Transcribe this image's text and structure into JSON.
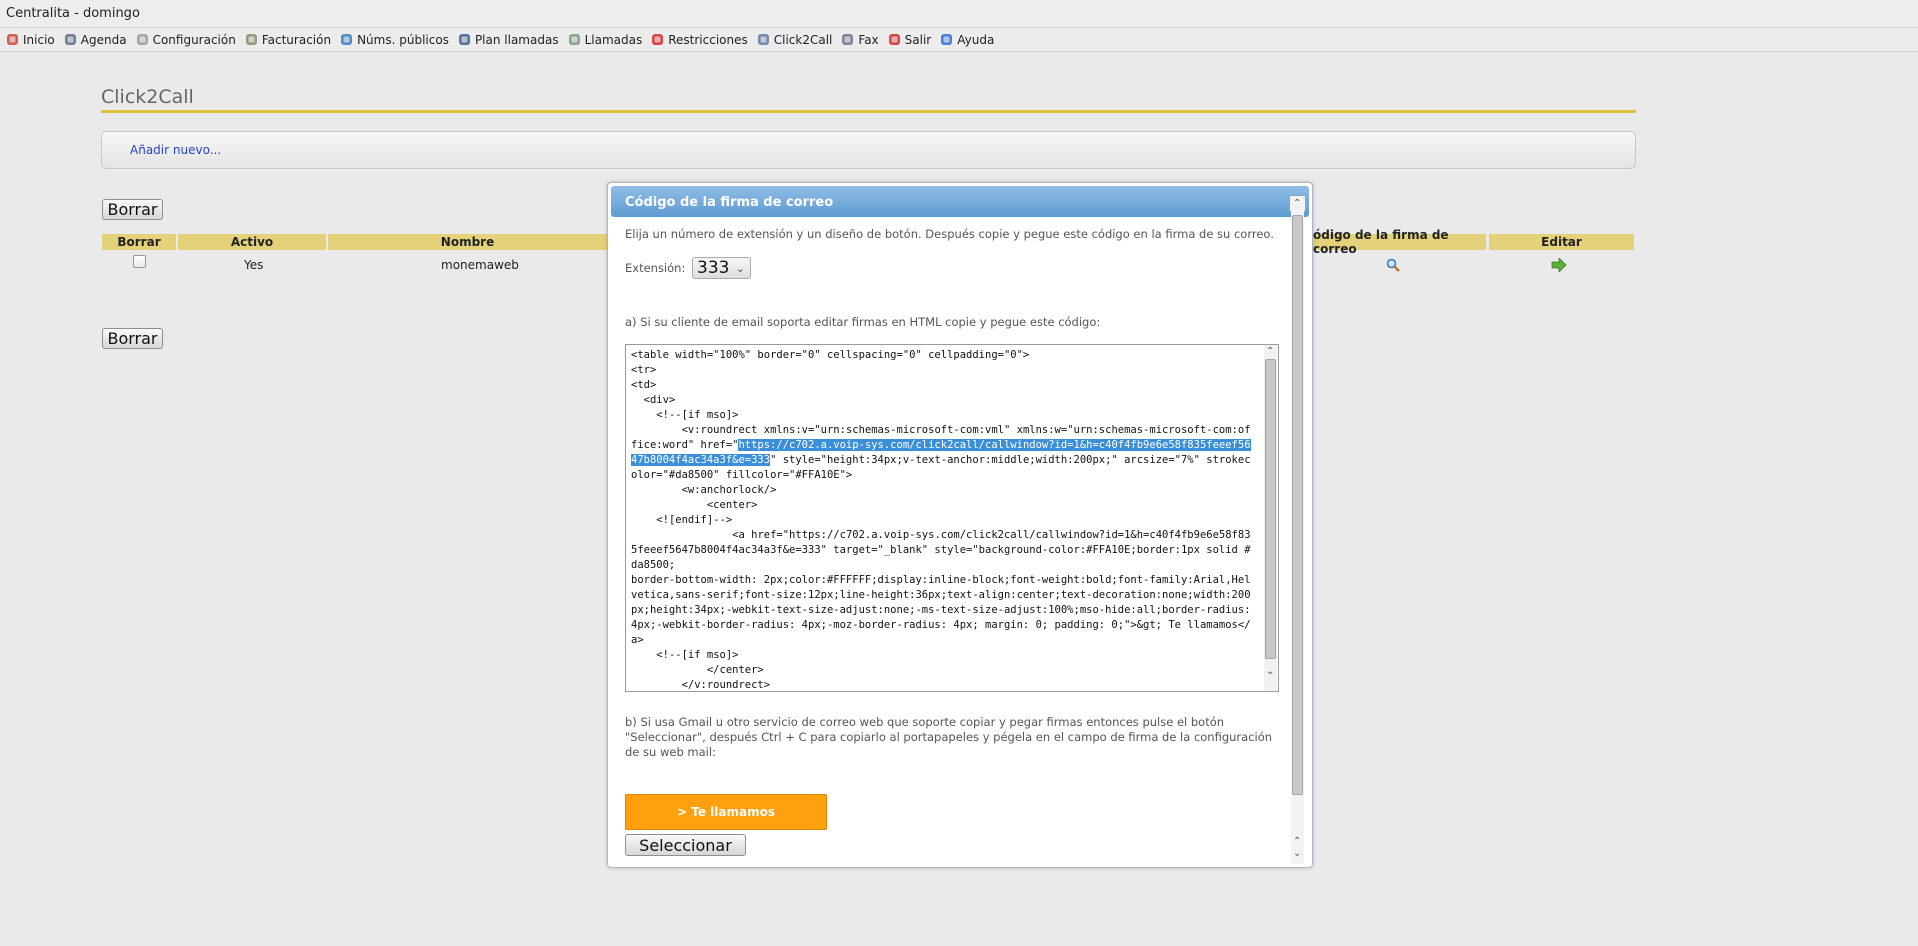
{
  "window": {
    "title": "Centralita - domingo"
  },
  "menu": [
    {
      "label": "Inicio",
      "icon": "home-icon",
      "color": "#c8493a"
    },
    {
      "label": "Agenda",
      "icon": "agenda-icon",
      "color": "#5a6f8a"
    },
    {
      "label": "Configuración",
      "icon": "gear-icon",
      "color": "#9a9a9a"
    },
    {
      "label": "Facturación",
      "icon": "billing-icon",
      "color": "#8a8a6a"
    },
    {
      "label": "Núms. públicos",
      "icon": "globe-icon",
      "color": "#3b7cc0"
    },
    {
      "label": "Plan llamadas",
      "icon": "plan-icon",
      "color": "#3f5f8f"
    },
    {
      "label": "Llamadas",
      "icon": "phone-icon",
      "color": "#7a9a7a"
    },
    {
      "label": "Restricciones",
      "icon": "stop-icon",
      "color": "#d22b2b"
    },
    {
      "label": "Click2Call",
      "icon": "window-icon",
      "color": "#5f7a9a"
    },
    {
      "label": "Fax",
      "icon": "fax-icon",
      "color": "#6f6f8f"
    },
    {
      "label": "Salir",
      "icon": "power-icon",
      "color": "#d22b2b"
    },
    {
      "label": "Ayuda",
      "icon": "help-icon",
      "color": "#2f6fd0"
    }
  ],
  "page": {
    "title": "Click2Call",
    "add_new": "Añadir nuevo...",
    "delete_button": "Borrar",
    "table": {
      "headers": [
        "Borrar",
        "Activo",
        "Nombre",
        "ódigo de la firma de correo",
        "Editar"
      ],
      "row": {
        "active": "Yes",
        "name": "monemaweb"
      }
    }
  },
  "dialog": {
    "title": "Código de la firma de correo",
    "intro": "Elija un número de extensión y un diseño de botón. Después copie y pegue este código en la firma de su correo.",
    "extension_label": "Extensión:",
    "extension_value": "333",
    "step_a": "a) Si su cliente de email soporta editar firmas en HTML copie y pegue este código:",
    "code_before": "<table width=\"100%\" border=\"0\" cellspacing=\"0\" cellpadding=\"0\">\n<tr>\n<td>\n  <div>\n    <!--[if mso]>\n        <v:roundrect xmlns:v=\"urn:schemas-microsoft-com:vml\" xmlns:w=\"urn:schemas-microsoft-com:office:word\" href=\"",
    "code_selected": "https://c702.a.voip-sys.com/click2call/callwindow?id=1&h=c40f4fb9e6e58f835feeef5647b8004f4ac34a3f&e=333",
    "code_after": "\" style=\"height:34px;v-text-anchor:middle;width:200px;\" arcsize=\"7%\" strokecolor=\"#da8500\" fillcolor=\"#FFA10E\">\n        <w:anchorlock/>\n            <center>\n    <![endif]-->\n                <a href=\"https://c702.a.voip-sys.com/click2call/callwindow?id=1&h=c40f4fb9e6e58f835feeef5647b8004f4ac34a3f&e=333\" target=\"_blank\" style=\"background-color:#FFA10E;border:1px solid #da8500;\nborder-bottom-width: 2px;color:#FFFFFF;display:inline-block;font-weight:bold;font-family:Arial,Helvetica,sans-serif;font-size:12px;line-height:36px;text-align:center;text-decoration:none;width:200px;height:34px;-webkit-text-size-adjust:none;-ms-text-size-adjust:100%;mso-hide:all;border-radius:4px;-webkit-border-radius: 4px;-moz-border-radius: 4px; margin: 0; padding: 0;\">&gt; Te llamamos</a>\n    <!--[if mso]>\n            </center>\n        </v:roundrect>",
    "step_b": "b) Si usa Gmail u otro servicio de correo web que soporte copiar y pegar firmas entonces pulse el botón \"Seleccionar\", después Ctrl + C para copiarlo al portapapeles y pégela en el campo de firma de la configuración de su web mail:",
    "preview_button": "> Te llamamos",
    "select_button": "Seleccionar",
    "button_color": "#FFA10E",
    "button_border": "#da8500"
  }
}
